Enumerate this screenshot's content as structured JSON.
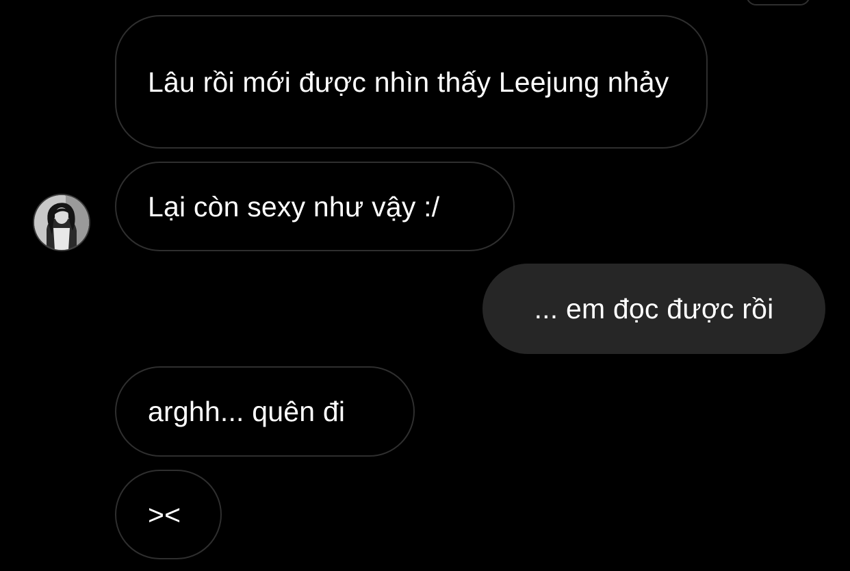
{
  "messages": [
    {
      "direction": "incoming",
      "text": "Lâu rồi mới được nhìn thấy Leejung nhảy"
    },
    {
      "direction": "incoming",
      "text": "Lại còn sexy như vậy :/"
    },
    {
      "direction": "outgoing",
      "text": "... em đọc được rồi"
    },
    {
      "direction": "incoming",
      "text": "arghh... quên đi"
    },
    {
      "direction": "incoming",
      "text": "><"
    }
  ],
  "avatar": {
    "icon": "contact-avatar-photo"
  },
  "colors": {
    "background": "#000000",
    "incoming_border": "#2f2f2f",
    "outgoing_bubble": "#262626",
    "text": "#ffffff"
  }
}
